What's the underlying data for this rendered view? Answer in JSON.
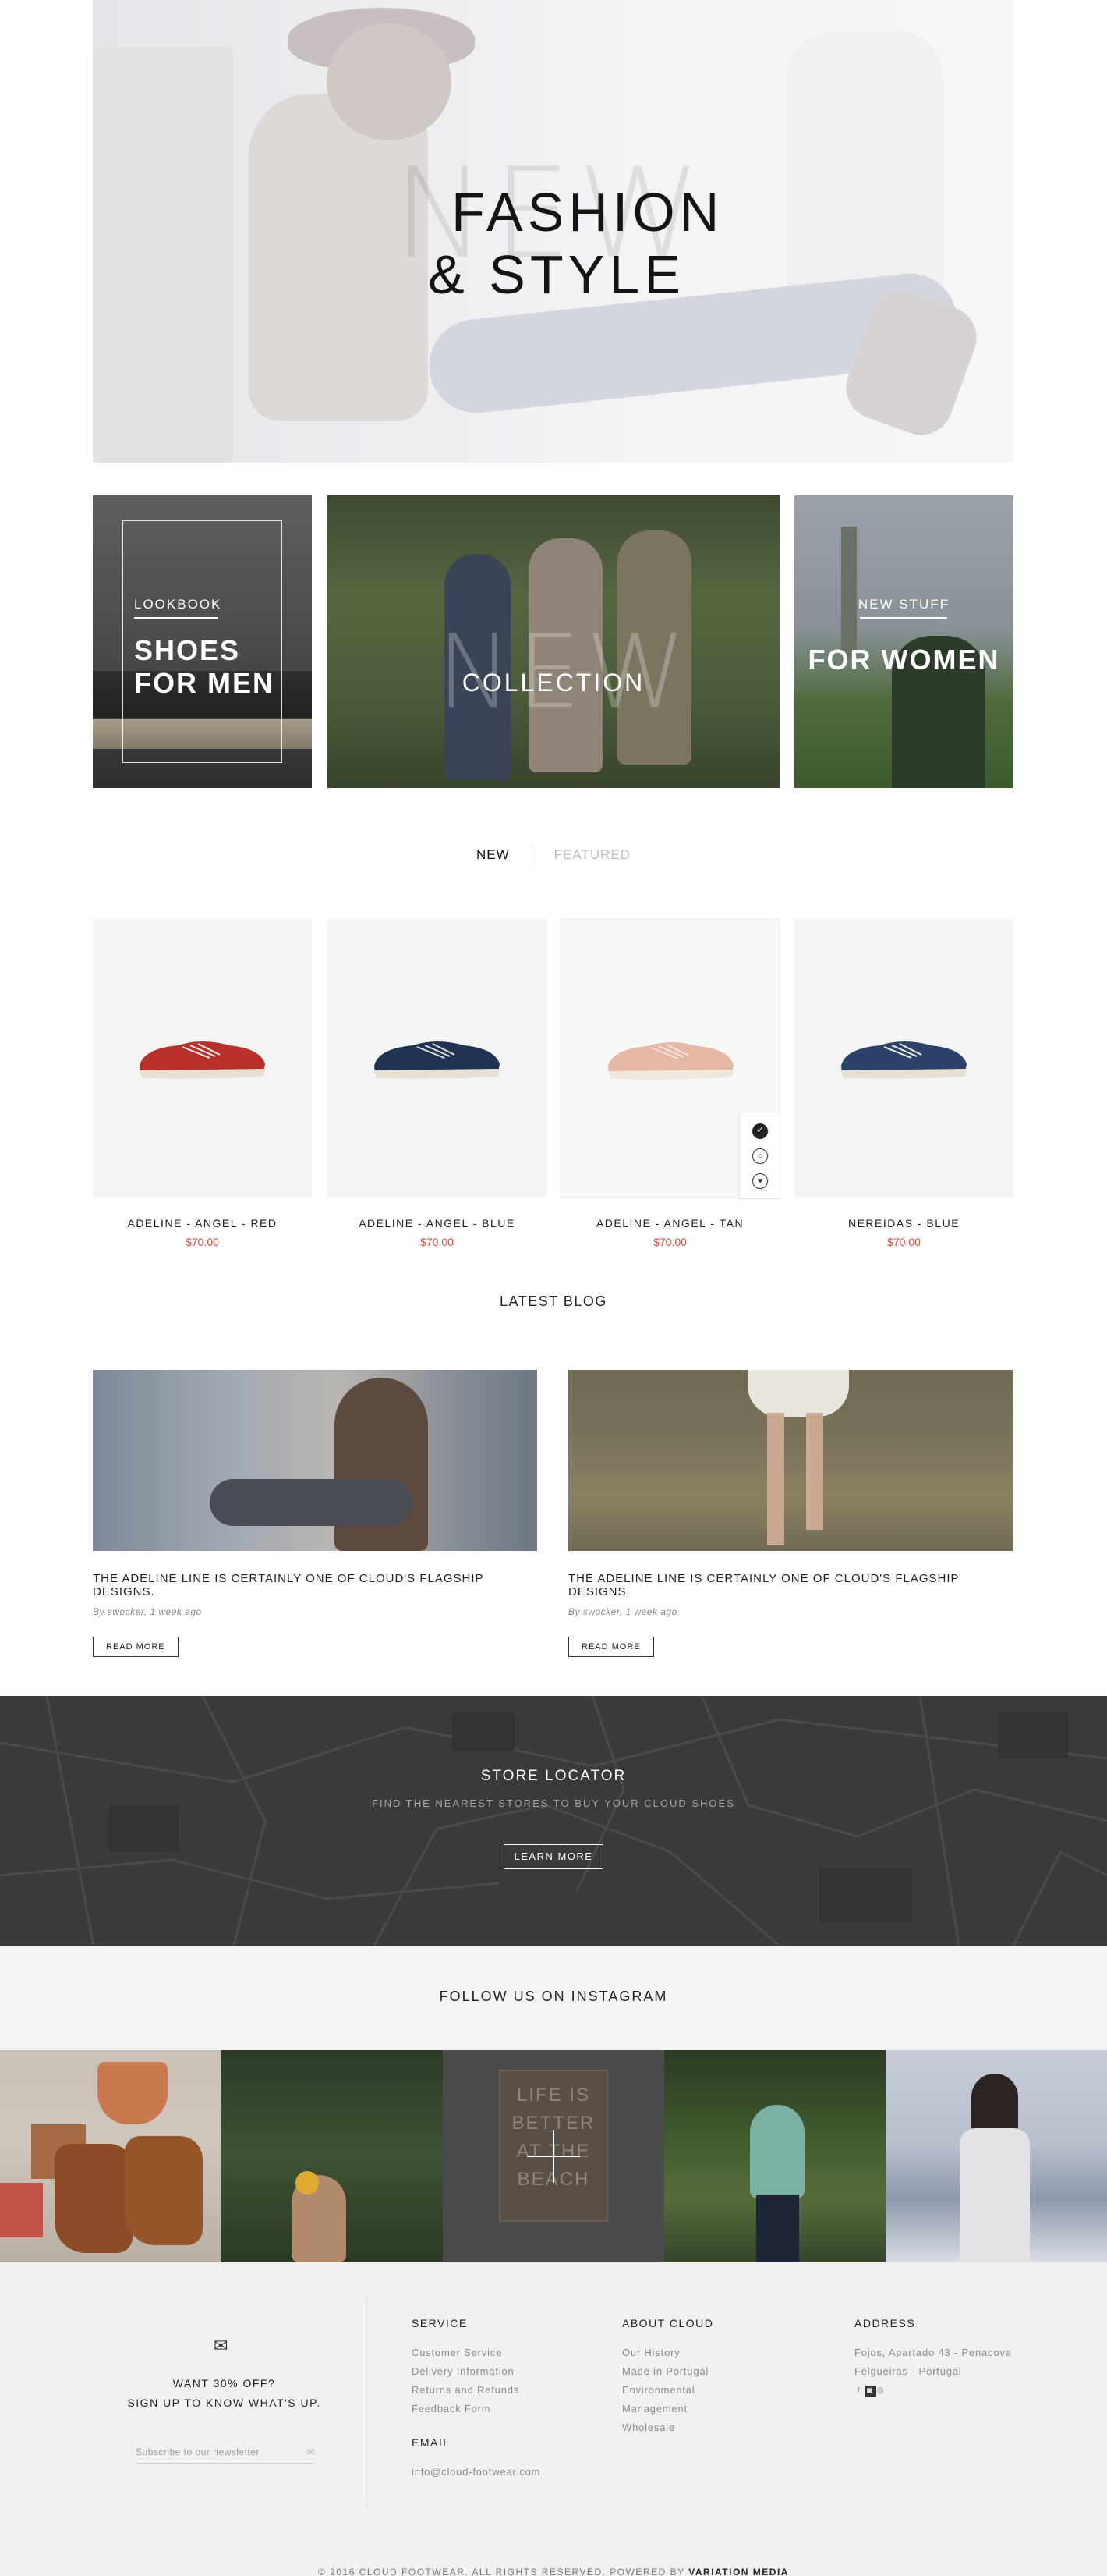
{
  "hero": {
    "ghost_word": "NEW",
    "title_line1": "FASHION",
    "title_line2": "& STYLE"
  },
  "promos": {
    "men": {
      "kicker": "LOOKBOOK",
      "line1": "SHOES",
      "line2": "FOR MEN"
    },
    "collection": {
      "ghost_word": "NEW",
      "label": "COLLECTION"
    },
    "women": {
      "kicker": "NEW STUFF",
      "label": "FOR WOMEN"
    }
  },
  "tabs": {
    "active": "NEW",
    "inactive": "FEATURED"
  },
  "products": [
    {
      "name": "ADELINE - ANGEL - RED",
      "price": "$70.00",
      "color": "#b8302a"
    },
    {
      "name": "ADELINE - ANGEL - BLUE",
      "price": "$70.00",
      "color": "#223352"
    },
    {
      "name": "ADELINE - ANGEL - TAN",
      "price": "$70.00",
      "color": "#e4b8a4"
    },
    {
      "name": "NEREIDAS - BLUE",
      "price": "$70.00",
      "color": "#2b4368"
    }
  ],
  "quick_icons": [
    "cart-icon",
    "zoom-icon",
    "heart-icon"
  ],
  "blog": {
    "section_title": "LATEST BLOG",
    "posts": [
      {
        "title": "THE ADELINE LINE IS CERTAINLY ONE OF CLOUD'S  FLAGSHIP DESIGNS.",
        "meta": "By swocker, 1 week ago",
        "button": "READ MORE"
      },
      {
        "title": "THE ADELINE LINE IS CERTAINLY ONE OF CLOUD'S  FLAGSHIP DESIGNS.",
        "meta": "By swocker, 1 week ago",
        "button": "READ MORE"
      }
    ]
  },
  "store": {
    "title": "STORE LOCATOR",
    "subtitle": "FIND THE NEAREST STORES TO BUY YOUR CLOUD SHOES",
    "button": "LEARN MORE"
  },
  "instagram": {
    "title": "FOLLOW US ON INSTAGRAM",
    "sign_text": "LIFE IS BETTER AT THE BEACH"
  },
  "footer": {
    "promo_line1": "WANT 30% OFF?",
    "promo_line2": "SIGN UP TO KNOW WHAT'S UP.",
    "newsletter_placeholder": "Subscribe to our newsletter",
    "service": {
      "heading": "SERVICE",
      "items": [
        "Customer Service",
        "Delivery Information",
        "Returns and Refunds",
        "Feedback Form"
      ]
    },
    "email": {
      "heading": "EMAIL",
      "value": "info@cloud-footwear.com"
    },
    "about": {
      "heading": "ABOUT CLOUD",
      "items": [
        "Our History",
        "Made in Portugal",
        "Environmental",
        "Management",
        "Wholesale"
      ]
    },
    "address": {
      "heading": "ADDRESS",
      "line1": "Fojos, Apartado 43 - Penacova",
      "line2": "Felgueiras - Portugal",
      "social": [
        "f",
        "instagram",
        "pinterest"
      ]
    },
    "copyright_text": "© 2016 CLOUD FOOTWEAR. ALL RIGHTS RESERVED. POWERED BY",
    "copyright_brand": "VARIATION MEDIA"
  },
  "colors": {
    "price_red": "#e0463e",
    "store_bg": "#3a3a3a",
    "footer_bg": "#f1f1f1"
  }
}
